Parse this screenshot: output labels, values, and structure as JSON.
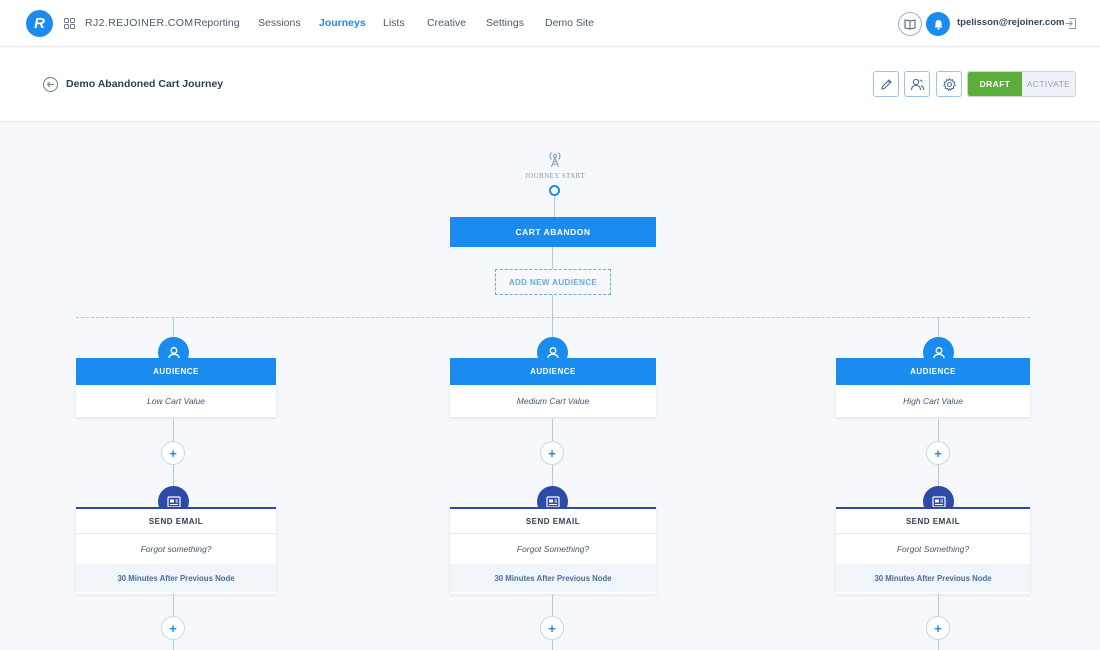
{
  "topnav": {
    "logo_letter": "R",
    "site_name": "RJ2.REJOINER.COM",
    "items": [
      {
        "label": "Reporting",
        "active": false
      },
      {
        "label": "Sessions",
        "active": false
      },
      {
        "label": "Journeys",
        "active": true
      },
      {
        "label": "Lists",
        "active": false
      },
      {
        "label": "Creative",
        "active": false
      },
      {
        "label": "Settings",
        "active": false
      },
      {
        "label": "Demo Site",
        "active": false
      }
    ],
    "user_email": "tpelisson@rejoiner.com",
    "icons": [
      "grid-icon",
      "book-icon",
      "bell-icon",
      "logout-icon"
    ],
    "accent_color": "#1a8cf0"
  },
  "subheader": {
    "title": "Demo Abandoned Cart Journey",
    "tools": [
      "pencil-icon",
      "users-icon",
      "gear-icon"
    ],
    "status": {
      "draft": "DRAFT",
      "activate": "ACTIVATE",
      "draft_color": "#5cad3c"
    }
  },
  "canvas": {
    "start_label": "JOURNEY START",
    "trigger": "CART ABANDON",
    "add_audience": "ADD NEW AUDIENCE",
    "branches": [
      {
        "audience_label": "AUDIENCE",
        "audience_name": "Low Cart Value",
        "email_label": "SEND EMAIL",
        "email_subject": "Forgot something?",
        "email_timing": "30 Minutes After Previous Node"
      },
      {
        "audience_label": "AUDIENCE",
        "audience_name": "Medium Cart Value",
        "email_label": "SEND EMAIL",
        "email_subject": "Forgot Something?",
        "email_timing": "30 Minutes After Previous Node"
      },
      {
        "audience_label": "AUDIENCE",
        "audience_name": "High Cart Value",
        "email_label": "SEND EMAIL",
        "email_subject": "Forgot Something?",
        "email_timing": "30 Minutes After Previous Node"
      }
    ],
    "plus_symbol": "+"
  }
}
